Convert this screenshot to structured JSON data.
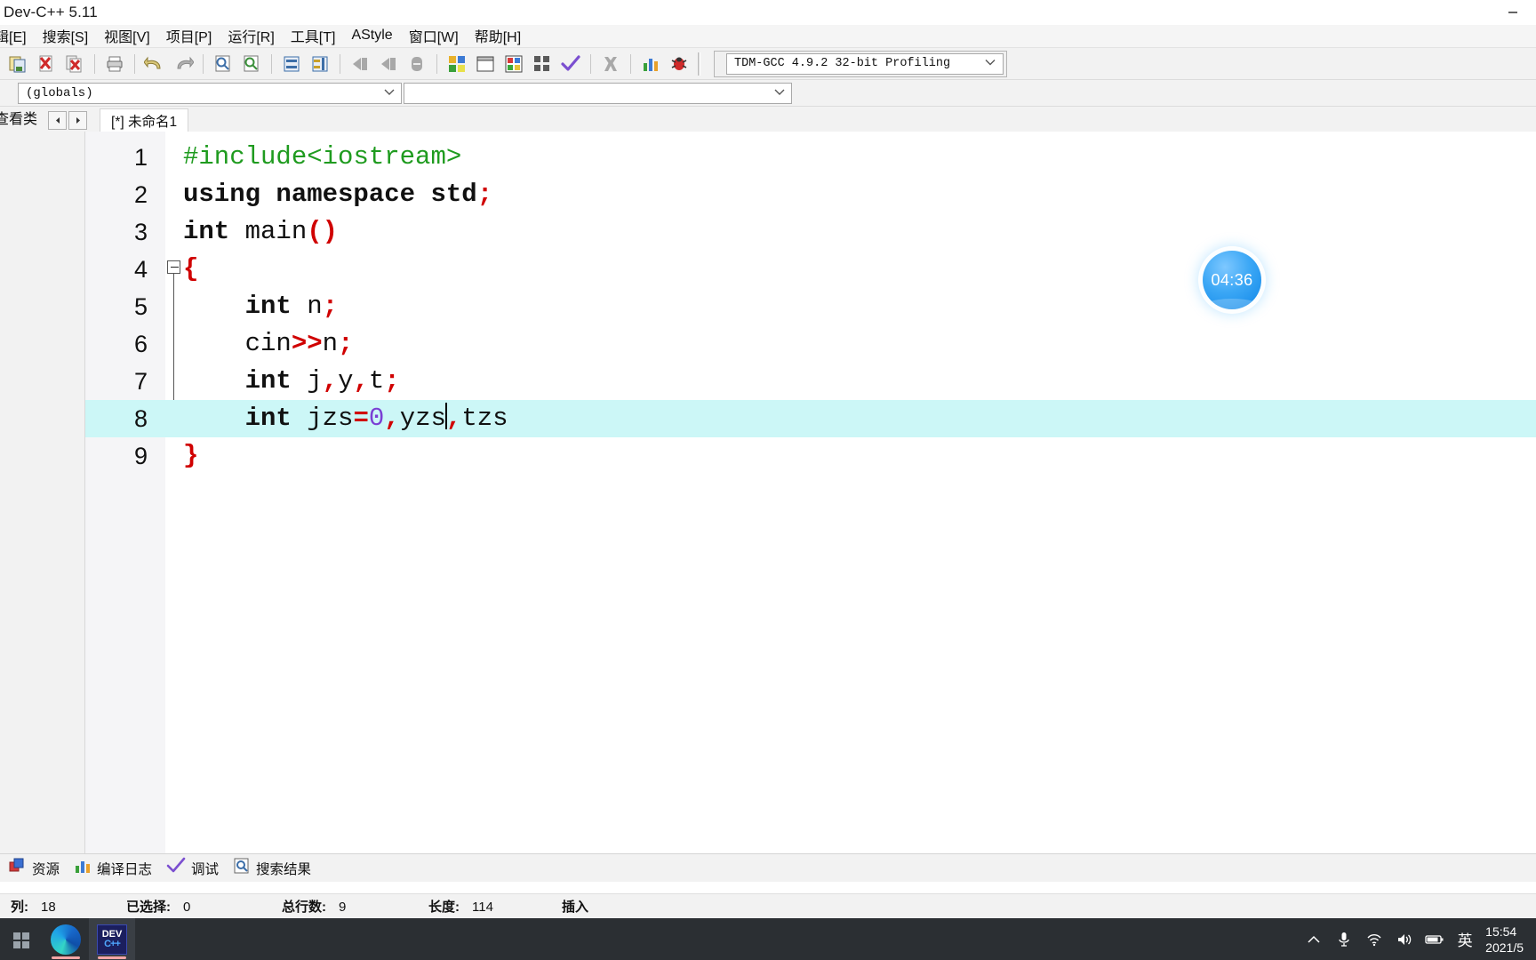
{
  "window": {
    "title": "Dev-C++ 5.11",
    "controls": [
      {
        "name": "minimize-button",
        "glyph": "minimize"
      }
    ]
  },
  "menubar": {
    "items": [
      {
        "label": "辑[E]",
        "name": "menu-edit"
      },
      {
        "label": "搜索[S]",
        "name": "menu-search"
      },
      {
        "label": "视图[V]",
        "name": "menu-view"
      },
      {
        "label": "项目[P]",
        "name": "menu-project"
      },
      {
        "label": "运行[R]",
        "name": "menu-run"
      },
      {
        "label": "工具[T]",
        "name": "menu-tools"
      },
      {
        "label": "AStyle",
        "name": "menu-astyle"
      },
      {
        "label": "窗口[W]",
        "name": "menu-window"
      },
      {
        "label": "帮助[H]",
        "name": "menu-help"
      }
    ]
  },
  "toolbar": {
    "buttons": [
      {
        "name": "new-file-icon",
        "title": "新建"
      },
      {
        "name": "close-file-icon",
        "title": "关闭"
      },
      {
        "name": "close-all-icon",
        "title": "全部关闭"
      },
      {
        "name": "print-icon",
        "title": "打印"
      },
      {
        "name": "undo-icon",
        "title": "撤销"
      },
      {
        "name": "redo-icon",
        "title": "重做"
      },
      {
        "name": "find-icon",
        "title": "查找"
      },
      {
        "name": "replace-icon",
        "title": "替换"
      },
      {
        "name": "goto-line-icon",
        "title": "转到行"
      },
      {
        "name": "indent-icon",
        "title": "缩进"
      },
      {
        "name": "back-icon",
        "title": "后退"
      },
      {
        "name": "forward-icon",
        "title": "前进"
      },
      {
        "name": "insert-icon",
        "title": "插入"
      },
      {
        "name": "compile-icon",
        "title": "编译"
      },
      {
        "name": "run-icon",
        "title": "运行"
      },
      {
        "name": "compile-run-icon",
        "title": "编译运行"
      },
      {
        "name": "rebuild-icon",
        "title": "重新编译"
      },
      {
        "name": "syntax-check-icon",
        "title": "语法检查"
      },
      {
        "name": "stop-icon",
        "title": "停止"
      },
      {
        "name": "profile-icon",
        "title": "性能分析"
      },
      {
        "name": "debug-icon",
        "title": "调试"
      }
    ],
    "compiler_set": "TDM-GCC 4.9.2 32-bit Profiling"
  },
  "classbar": {
    "scope": "(globals)",
    "member": ""
  },
  "tabstrip": {
    "view_class_label": "查看类",
    "prev_arrow": "◄",
    "next_arrow": "►",
    "tabs": [
      {
        "label": "[*] 未命名1",
        "name": "file-tab-untitled1",
        "active": true
      }
    ]
  },
  "editor": {
    "lines": [
      {
        "no": "1",
        "tokens": [
          {
            "t": "#include",
            "c": "pre"
          },
          {
            "t": "<iostream>",
            "c": "pre"
          }
        ]
      },
      {
        "no": "2",
        "tokens": [
          {
            "t": "using",
            "c": "kw"
          },
          {
            "t": " ",
            "c": "id"
          },
          {
            "t": "namespace",
            "c": "kw"
          },
          {
            "t": " ",
            "c": "id"
          },
          {
            "t": "std",
            "c": "kw"
          },
          {
            "t": ";",
            "c": "punc"
          }
        ]
      },
      {
        "no": "3",
        "tokens": [
          {
            "t": "int",
            "c": "kw"
          },
          {
            "t": " main",
            "c": "id"
          },
          {
            "t": "()",
            "c": "punc"
          }
        ]
      },
      {
        "no": "4",
        "fold": true,
        "tokens": [
          {
            "t": "{",
            "c": "punc"
          }
        ]
      },
      {
        "no": "5",
        "tokens": [
          {
            "t": "    ",
            "c": "id"
          },
          {
            "t": "int",
            "c": "kw"
          },
          {
            "t": " n",
            "c": "id"
          },
          {
            "t": ";",
            "c": "punc"
          }
        ]
      },
      {
        "no": "6",
        "tokens": [
          {
            "t": "    cin",
            "c": "id"
          },
          {
            "t": ">>",
            "c": "punc"
          },
          {
            "t": "n",
            "c": "id"
          },
          {
            "t": ";",
            "c": "punc"
          }
        ]
      },
      {
        "no": "7",
        "tokens": [
          {
            "t": "    ",
            "c": "id"
          },
          {
            "t": "int",
            "c": "kw"
          },
          {
            "t": " j",
            "c": "id"
          },
          {
            "t": ",",
            "c": "punc"
          },
          {
            "t": "y",
            "c": "id"
          },
          {
            "t": ",",
            "c": "punc"
          },
          {
            "t": "t",
            "c": "id"
          },
          {
            "t": ";",
            "c": "punc"
          }
        ]
      },
      {
        "no": "8",
        "highlight": true,
        "caret_after": 15,
        "tokens": [
          {
            "t": "    ",
            "c": "id"
          },
          {
            "t": "int",
            "c": "kw"
          },
          {
            "t": " jzs",
            "c": "id"
          },
          {
            "t": "=",
            "c": "punc"
          },
          {
            "t": "0",
            "c": "num"
          },
          {
            "t": ",",
            "c": "punc"
          },
          {
            "t": "yzs",
            "c": "id"
          },
          {
            "t": "|caret|",
            "c": "caret"
          },
          {
            "t": ",",
            "c": "punc"
          },
          {
            "t": "tzs",
            "c": "id"
          }
        ]
      },
      {
        "no": "9",
        "tokens": [
          {
            "t": "}",
            "c": "punc"
          }
        ]
      }
    ]
  },
  "timer_badge": {
    "value": "04:36",
    "color": "#2ba0f0"
  },
  "panel_tabs": [
    {
      "label": "资源",
      "name": "panel-tab-resources",
      "icon": "resources-icon"
    },
    {
      "label": "编译日志",
      "name": "panel-tab-compile-log",
      "icon": "compile-log-icon"
    },
    {
      "label": "调试",
      "name": "panel-tab-debug",
      "icon": "debug-check-icon"
    },
    {
      "label": "搜索结果",
      "name": "panel-tab-search-results",
      "icon": "search-results-icon"
    }
  ],
  "statusbar": {
    "cells": [
      {
        "label": "列:",
        "value": "18",
        "name": "status-column"
      },
      {
        "label": "已选择:",
        "value": "0",
        "name": "status-selected"
      },
      {
        "label": "总行数:",
        "value": "9",
        "name": "status-total-lines"
      },
      {
        "label": "长度:",
        "value": "114",
        "name": "status-length"
      },
      {
        "label": "插入",
        "value": "",
        "name": "status-insert-mode"
      }
    ]
  },
  "taskbar": {
    "apps": [
      {
        "name": "taskbar-edge",
        "label": "Microsoft Edge",
        "icon": "edge-icon"
      },
      {
        "name": "taskbar-devcpp",
        "label": "Dev-C++",
        "icon": "dev-icon",
        "active": true
      }
    ],
    "tray": [
      {
        "name": "show-hidden-icons-icon",
        "glyph": "chevron-up"
      },
      {
        "name": "microphone-icon",
        "glyph": "mic"
      },
      {
        "name": "network-icon",
        "glyph": "wifi"
      },
      {
        "name": "volume-icon",
        "glyph": "speaker"
      },
      {
        "name": "battery-icon",
        "glyph": "battery"
      }
    ],
    "ime": "英",
    "clock": {
      "time": "15:54",
      "date": "2021/5"
    }
  }
}
